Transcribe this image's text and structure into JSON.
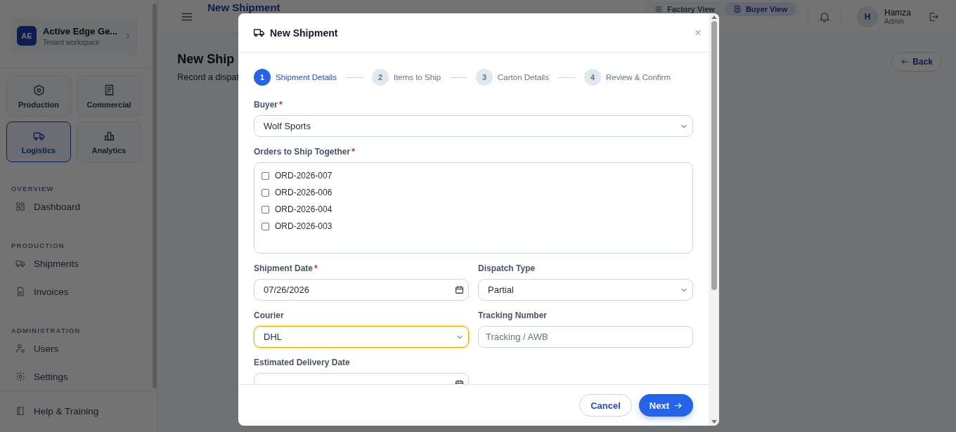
{
  "sidebar": {
    "workspace": {
      "initials": "AE",
      "name": "Active Edge Ge...",
      "subtitle": "Tenant workspace"
    },
    "modules": [
      {
        "label": "Production",
        "selected": false
      },
      {
        "label": "Commercial",
        "selected": false
      },
      {
        "label": "Logistics",
        "selected": true
      },
      {
        "label": "Analytics",
        "selected": false
      }
    ],
    "sections": [
      {
        "title": "OVERVIEW",
        "items": [
          {
            "label": "Dashboard"
          }
        ]
      },
      {
        "title": "PRODUCTION",
        "items": [
          {
            "label": "Shipments"
          },
          {
            "label": "Invoices"
          }
        ]
      },
      {
        "title": "ADMINISTRATION",
        "items": [
          {
            "label": "Users"
          },
          {
            "label": "Settings"
          }
        ]
      }
    ],
    "footer_items": [
      {
        "label": "Help & Training"
      }
    ]
  },
  "header": {
    "title": "New Shipment",
    "view_toggle": [
      {
        "label": "Factory View",
        "selected": false
      },
      {
        "label": "Buyer View",
        "selected": true
      }
    ],
    "user": {
      "initial": "H",
      "name": "Hamza",
      "role": "Admin"
    }
  },
  "page": {
    "title": "New Ship",
    "subtitle": "Record a dispat",
    "back_button": "Back"
  },
  "modal": {
    "title": "New Shipment",
    "close": "×",
    "steps": [
      {
        "number": "1",
        "label": "Shipment Details",
        "selected": true
      },
      {
        "number": "2",
        "label": "Items to Ship",
        "selected": false
      },
      {
        "number": "3",
        "label": "Carton Details",
        "selected": false
      },
      {
        "number": "4",
        "label": "Review & Confirm",
        "selected": false
      }
    ],
    "fields": [
      {
        "kind": "select",
        "label": "Buyer",
        "required_mark": "*",
        "focused": false,
        "value": "Wolf Sports"
      },
      {
        "kind": "checklist",
        "label": "Orders to Ship Together",
        "required_mark": "*",
        "focused": false,
        "options": [
          {
            "label": "ORD-2026-007",
            "checked": false
          },
          {
            "label": "ORD-2026-006",
            "checked": false
          },
          {
            "label": "ORD-2026-004",
            "checked": false
          },
          {
            "label": "ORD-2026-003",
            "checked": false
          }
        ]
      },
      {
        "kind": "date",
        "label": "Shipment Date",
        "required_mark": "*",
        "focused": false,
        "value": "07/26/2026"
      },
      {
        "kind": "select",
        "label": "Dispatch Type",
        "focused": false,
        "value": "Partial"
      },
      {
        "kind": "select",
        "label": "Courier",
        "focused": true,
        "value": "DHL"
      },
      {
        "kind": "text",
        "label": "Tracking Number",
        "focused": false,
        "placeholder": "Tracking / AWB"
      },
      {
        "kind": "date",
        "label": "Estimated Delivery Date",
        "focused": false
      }
    ],
    "buttons": [
      {
        "kind": "secondary",
        "label": "Cancel"
      },
      {
        "kind": "primary",
        "label": "Next"
      }
    ]
  }
}
